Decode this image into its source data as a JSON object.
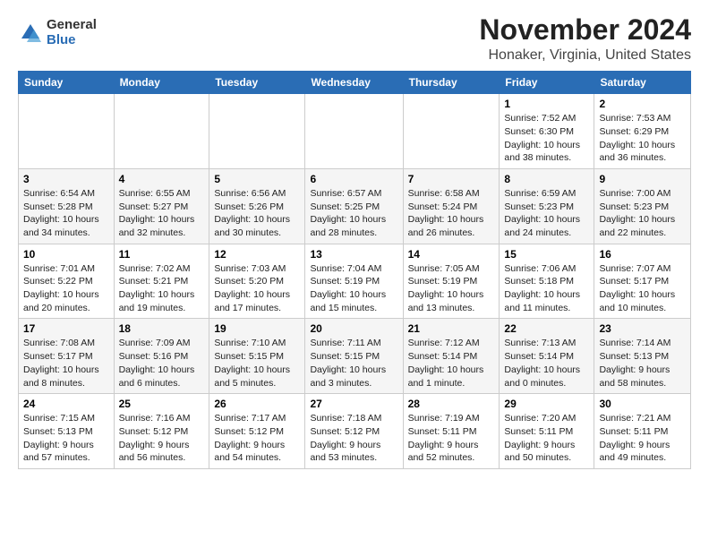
{
  "logo": {
    "general": "General",
    "blue": "Blue"
  },
  "header": {
    "month": "November 2024",
    "location": "Honaker, Virginia, United States"
  },
  "weekdays": [
    "Sunday",
    "Monday",
    "Tuesday",
    "Wednesday",
    "Thursday",
    "Friday",
    "Saturday"
  ],
  "weeks": [
    [
      {
        "day": "",
        "info": ""
      },
      {
        "day": "",
        "info": ""
      },
      {
        "day": "",
        "info": ""
      },
      {
        "day": "",
        "info": ""
      },
      {
        "day": "",
        "info": ""
      },
      {
        "day": "1",
        "info": "Sunrise: 7:52 AM\nSunset: 6:30 PM\nDaylight: 10 hours and 38 minutes."
      },
      {
        "day": "2",
        "info": "Sunrise: 7:53 AM\nSunset: 6:29 PM\nDaylight: 10 hours and 36 minutes."
      }
    ],
    [
      {
        "day": "3",
        "info": "Sunrise: 6:54 AM\nSunset: 5:28 PM\nDaylight: 10 hours and 34 minutes."
      },
      {
        "day": "4",
        "info": "Sunrise: 6:55 AM\nSunset: 5:27 PM\nDaylight: 10 hours and 32 minutes."
      },
      {
        "day": "5",
        "info": "Sunrise: 6:56 AM\nSunset: 5:26 PM\nDaylight: 10 hours and 30 minutes."
      },
      {
        "day": "6",
        "info": "Sunrise: 6:57 AM\nSunset: 5:25 PM\nDaylight: 10 hours and 28 minutes."
      },
      {
        "day": "7",
        "info": "Sunrise: 6:58 AM\nSunset: 5:24 PM\nDaylight: 10 hours and 26 minutes."
      },
      {
        "day": "8",
        "info": "Sunrise: 6:59 AM\nSunset: 5:23 PM\nDaylight: 10 hours and 24 minutes."
      },
      {
        "day": "9",
        "info": "Sunrise: 7:00 AM\nSunset: 5:23 PM\nDaylight: 10 hours and 22 minutes."
      }
    ],
    [
      {
        "day": "10",
        "info": "Sunrise: 7:01 AM\nSunset: 5:22 PM\nDaylight: 10 hours and 20 minutes."
      },
      {
        "day": "11",
        "info": "Sunrise: 7:02 AM\nSunset: 5:21 PM\nDaylight: 10 hours and 19 minutes."
      },
      {
        "day": "12",
        "info": "Sunrise: 7:03 AM\nSunset: 5:20 PM\nDaylight: 10 hours and 17 minutes."
      },
      {
        "day": "13",
        "info": "Sunrise: 7:04 AM\nSunset: 5:19 PM\nDaylight: 10 hours and 15 minutes."
      },
      {
        "day": "14",
        "info": "Sunrise: 7:05 AM\nSunset: 5:19 PM\nDaylight: 10 hours and 13 minutes."
      },
      {
        "day": "15",
        "info": "Sunrise: 7:06 AM\nSunset: 5:18 PM\nDaylight: 10 hours and 11 minutes."
      },
      {
        "day": "16",
        "info": "Sunrise: 7:07 AM\nSunset: 5:17 PM\nDaylight: 10 hours and 10 minutes."
      }
    ],
    [
      {
        "day": "17",
        "info": "Sunrise: 7:08 AM\nSunset: 5:17 PM\nDaylight: 10 hours and 8 minutes."
      },
      {
        "day": "18",
        "info": "Sunrise: 7:09 AM\nSunset: 5:16 PM\nDaylight: 10 hours and 6 minutes."
      },
      {
        "day": "19",
        "info": "Sunrise: 7:10 AM\nSunset: 5:15 PM\nDaylight: 10 hours and 5 minutes."
      },
      {
        "day": "20",
        "info": "Sunrise: 7:11 AM\nSunset: 5:15 PM\nDaylight: 10 hours and 3 minutes."
      },
      {
        "day": "21",
        "info": "Sunrise: 7:12 AM\nSunset: 5:14 PM\nDaylight: 10 hours and 1 minute."
      },
      {
        "day": "22",
        "info": "Sunrise: 7:13 AM\nSunset: 5:14 PM\nDaylight: 10 hours and 0 minutes."
      },
      {
        "day": "23",
        "info": "Sunrise: 7:14 AM\nSunset: 5:13 PM\nDaylight: 9 hours and 58 minutes."
      }
    ],
    [
      {
        "day": "24",
        "info": "Sunrise: 7:15 AM\nSunset: 5:13 PM\nDaylight: 9 hours and 57 minutes."
      },
      {
        "day": "25",
        "info": "Sunrise: 7:16 AM\nSunset: 5:12 PM\nDaylight: 9 hours and 56 minutes."
      },
      {
        "day": "26",
        "info": "Sunrise: 7:17 AM\nSunset: 5:12 PM\nDaylight: 9 hours and 54 minutes."
      },
      {
        "day": "27",
        "info": "Sunrise: 7:18 AM\nSunset: 5:12 PM\nDaylight: 9 hours and 53 minutes."
      },
      {
        "day": "28",
        "info": "Sunrise: 7:19 AM\nSunset: 5:11 PM\nDaylight: 9 hours and 52 minutes."
      },
      {
        "day": "29",
        "info": "Sunrise: 7:20 AM\nSunset: 5:11 PM\nDaylight: 9 hours and 50 minutes."
      },
      {
        "day": "30",
        "info": "Sunrise: 7:21 AM\nSunset: 5:11 PM\nDaylight: 9 hours and 49 minutes."
      }
    ]
  ]
}
